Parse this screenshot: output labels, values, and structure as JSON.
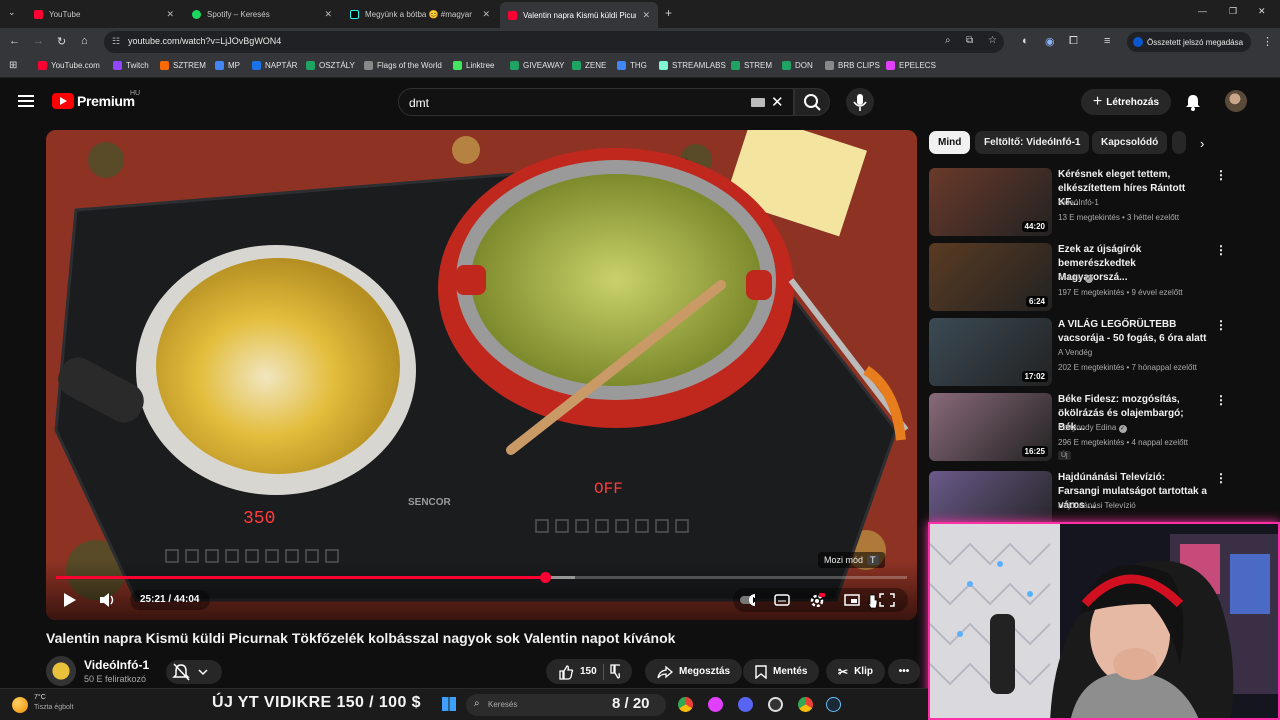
{
  "browser": {
    "tabs": [
      {
        "title": "YouTube",
        "favicon_color": "#ff0033",
        "active": false
      },
      {
        "title": "Spotify – Keresés",
        "favicon_color": "#1ed760",
        "active": false
      },
      {
        "title": "Megyünk a bótba 😊 #magyar",
        "favicon_color": "#000000",
        "active": false
      },
      {
        "title": "Valentin napra Kismü küldi Picur",
        "favicon_color": "#ff0033",
        "active": true
      }
    ],
    "new_tab": "+",
    "url": "youtube.com/watch?v=LjJOvBgWON4",
    "password_button": "Összetett jelszó megadása",
    "bookmarks": [
      {
        "label": "YouTube.com",
        "color": "#ff0033"
      },
      {
        "label": "Twitch",
        "color": "#9146ff"
      },
      {
        "label": "SZTREM",
        "color": "#ff6a00"
      },
      {
        "label": "MP",
        "color": "#4285f4"
      },
      {
        "label": "NAPTÁR",
        "color": "#1a73e8"
      },
      {
        "label": "OSZTÁLY",
        "color": "#1ea362"
      },
      {
        "label": "Flags of the World",
        "color": "#888888"
      },
      {
        "label": "Linktree",
        "color": "#43e55e"
      },
      {
        "label": "GIVEAWAY",
        "color": "#1ea362"
      },
      {
        "label": "ZENE",
        "color": "#1ea362"
      },
      {
        "label": "THG",
        "color": "#4285f4"
      },
      {
        "label": "STREAMLABS",
        "color": "#80f5d2"
      },
      {
        "label": "STREM",
        "color": "#1ea362"
      },
      {
        "label": "DON",
        "color": "#1ea362"
      },
      {
        "label": "BRB CLIPS",
        "color": "#888888"
      },
      {
        "label": "EPELECS",
        "color": "#e040fb"
      }
    ]
  },
  "youtube": {
    "brand": "Premium",
    "country": "HU",
    "search_query": "dmt",
    "create_label": "Létrehozás"
  },
  "player": {
    "cinema_mode_label": "Mozi mód",
    "cinema_mode_key": "T",
    "time_current": "25:21",
    "time_total": "44:04",
    "time_display": "25:21 / 44:04",
    "progress_fraction": 0.575,
    "buffered_fraction": 0.61,
    "cooker_left_display": "350",
    "cooker_right_display": "OFF",
    "cooker_brand": "SENCOR"
  },
  "video": {
    "title": "Valentin napra Kismü küldi Picurnak Tökfőzelék kolbásszal nagyok sok Valentin napot kívánok",
    "channel": "VideóInfó-1",
    "subscribers": "50 E feliratkozó",
    "likes": "150",
    "share_label": "Megosztás",
    "save_label": "Mentés",
    "clip_label": "Klip",
    "more_label": "•••"
  },
  "sidebar": {
    "chips": [
      {
        "label": "Mind",
        "active": true
      },
      {
        "label": "Feltöltő: VideóInfó-1",
        "active": false
      },
      {
        "label": "Kapcsolódó",
        "active": false
      }
    ],
    "recommendations": [
      {
        "title": "Kérésnek eleget tettem, elkészítettem híres Rántott KF...",
        "channel": "VideóInfó-1",
        "meta": "13 E megtekintés • 3 héttel ezelőtt",
        "duration": "44:20",
        "verified": false,
        "thumb_color": "#6a3a2a"
      },
      {
        "title": "Ezek az újságírók bemerészkedtek Magyarorszá...",
        "channel": "444.hu",
        "meta": "197 E megtekintés • 9 évvel ezelőtt",
        "duration": "6:24",
        "verified": true,
        "thumb_color": "#5a3b22"
      },
      {
        "title": "A VILÁG LEGŐRÜLTEBB vacsorája - 50 fogás, 6 óra alatt",
        "channel": "A Vendég",
        "meta": "202 E megtekintés • 7 hónappal ezelőtt",
        "duration": "17:02",
        "verified": false,
        "thumb_color": "#3b4a55"
      },
      {
        "title": "Béke Fidesz: mozgósítás, ökölrázás és olajembargó; Bék...",
        "channel": "Pottyondy Edina",
        "meta": "296 E megtekintés • 4 nappal ezelőtt",
        "duration": "16:25",
        "verified": true,
        "badge": "Új",
        "thumb_color": "#8a6a7a"
      },
      {
        "title": "Hajdúnánási Televízió: Farsangi mulatságot tartottak a város ...",
        "channel": "Hajdúnánási Televízió",
        "meta": "",
        "duration": "",
        "verified": false,
        "thumb_color": "#6a5a8a"
      }
    ]
  },
  "taskbar": {
    "temperature": "7°C",
    "weather": "Tiszta égbolt",
    "banner": "ÚJ YT VIDIKRE 150 / 100 $",
    "search_placeholder": "Keresés",
    "goal": "8 / 20"
  },
  "colors": {
    "accent": "#ff0033",
    "overlay_pink": "#ff2fa8",
    "bg": "#0f0f0f"
  }
}
